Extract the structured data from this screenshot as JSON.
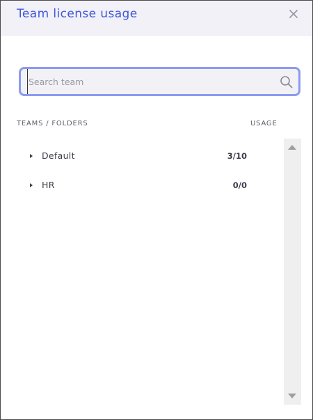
{
  "dialog": {
    "title": "Team license usage",
    "close_icon": "close-icon"
  },
  "search": {
    "placeholder": "Search team",
    "value": "",
    "icon": "search-icon"
  },
  "columns": {
    "teams": "TEAMS / FOLDERS",
    "usage": "USAGE"
  },
  "rows": [
    {
      "label": "Default",
      "usage": "3/10",
      "icon": "caret-right-icon"
    },
    {
      "label": "HR",
      "usage": "0/0",
      "icon": "caret-right-icon"
    }
  ],
  "colors": {
    "accent": "#4157d8",
    "focus_ring": "#8b9af0",
    "header_bg": "#f1f1f7"
  }
}
